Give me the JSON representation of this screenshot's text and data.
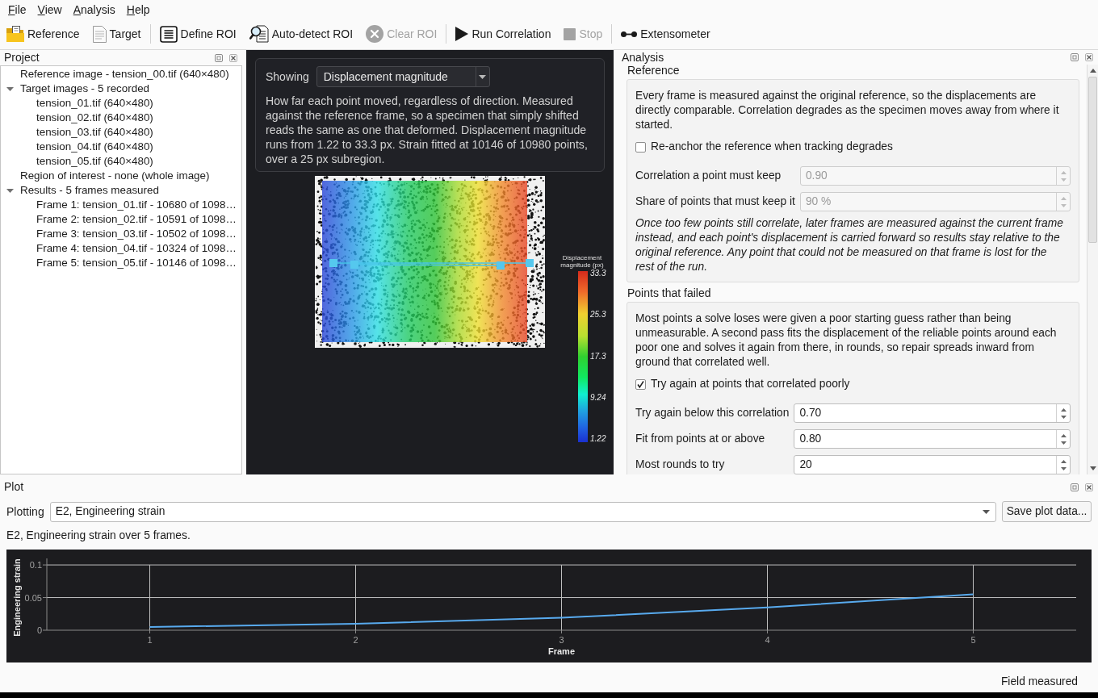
{
  "menu": [
    "File",
    "View",
    "Analysis",
    "Help"
  ],
  "toolbar": {
    "groups": [
      [
        {
          "label": "Reference",
          "disabled": false
        },
        {
          "label": "Target",
          "disabled": false
        }
      ],
      [
        {
          "label": "Define ROI",
          "disabled": false
        },
        {
          "label": "Auto-detect ROI",
          "disabled": false
        },
        {
          "label": "Clear ROI",
          "disabled": true
        }
      ],
      [
        {
          "label": "Run Correlation",
          "disabled": false
        },
        {
          "label": "Stop",
          "disabled": true
        }
      ],
      [
        {
          "label": "Extensometer",
          "disabled": false
        }
      ]
    ]
  },
  "project": {
    "title": "Project",
    "tree": [
      {
        "label": "Reference image - tension_00.tif (640×480)"
      },
      {
        "label": "Target images - 5 recorded",
        "expanded": true,
        "children": [
          {
            "label": "tension_01.tif (640×480)"
          },
          {
            "label": "tension_02.tif (640×480)"
          },
          {
            "label": "tension_03.tif (640×480)"
          },
          {
            "label": "tension_04.tif (640×480)"
          },
          {
            "label": "tension_05.tif (640×480)"
          }
        ]
      },
      {
        "label": "Region of interest - none (whole image)"
      },
      {
        "label": "Results - 5 frames measured",
        "expanded": true,
        "children": [
          {
            "label": "Frame 1: tension_01.tif - 10680 of 1098…"
          },
          {
            "label": "Frame 2: tension_02.tif - 10591 of 1098…"
          },
          {
            "label": "Frame 3: tension_03.tif - 10502 of 1098…"
          },
          {
            "label": "Frame 4: tension_04.tif - 10324 of 1098…"
          },
          {
            "label": "Frame 5: tension_05.tif - 10146 of 1098…"
          }
        ]
      }
    ]
  },
  "viewer": {
    "showing_label": "Showing",
    "showing_value": "Displacement magnitude",
    "description": "How far each point moved, regardless of direction. Measured against the reference frame, so a specimen that simply shifted reads the same as one that deformed. Displacement magnitude runs from 1.22 to 33.3 px. Strain fitted at 10146 of 10980 points, over a 25 px subregion.",
    "colorbar": {
      "title": "Displacement magnitude (px)",
      "ticks": [
        "33.3",
        "25.3",
        "17.3",
        "9.24",
        "1.22"
      ]
    }
  },
  "analysis": {
    "title": "Analysis",
    "groups": [
      {
        "title": "Reference",
        "items": [
          {
            "kind": "text",
            "text": "Every frame is measured against the original reference, so the displacements are directly comparable. Correlation degrades as the specimen moves away from where it started."
          },
          {
            "kind": "checkbox",
            "label": "Re-anchor the reference when tracking degrades",
            "checked": false
          },
          {
            "kind": "spin",
            "label": "Correlation a point must keep",
            "value": "0.90",
            "disabled": true
          },
          {
            "kind": "spin",
            "label": "Share of points that must keep it",
            "value": "90 %",
            "disabled": true
          },
          {
            "kind": "note",
            "text": "Once too few points still correlate, later frames are measured against the current frame instead, and each point's displacement is carried forward so results stay relative to the original reference. Any point that could not be measured on that frame is lost for the rest of the run."
          }
        ]
      },
      {
        "title": "Points that failed",
        "items": [
          {
            "kind": "text",
            "text": "Most points a solve loses were given a poor starting guess rather than being unmeasurable. A second pass fits the displacement of the reliable points around each poor one and solves it again from there, in rounds, so repair spreads inward from ground that correlated well."
          },
          {
            "kind": "checkbox",
            "label": "Try again at points that correlated poorly",
            "checked": true
          },
          {
            "kind": "spin",
            "label": "Try again below this correlation",
            "value": "0.70",
            "disabled": false
          },
          {
            "kind": "spin",
            "label": "Fit from points at or above",
            "value": "0.80",
            "disabled": false
          },
          {
            "kind": "spin",
            "label": "Most rounds to try",
            "value": "20",
            "disabled": false
          }
        ]
      }
    ]
  },
  "plot": {
    "title": "Plot",
    "plotting_label": "Plotting",
    "plotting_value": "E2, Engineering strain",
    "save_button": "Save plot data...",
    "caption": "E2, Engineering strain over 5 frames.",
    "chart_data": {
      "type": "line",
      "xlabel": "Frame",
      "ylabel": "Engineering strain",
      "x": [
        1,
        2,
        3,
        4,
        5
      ],
      "series": [
        {
          "color": "#58aaee",
          "values": [
            0.005,
            0.01,
            0.019,
            0.035,
            0.055
          ]
        }
      ],
      "xlim": [
        0.5,
        5.5
      ],
      "ylim": [
        0,
        0.11
      ],
      "xticks": [
        1,
        2,
        3,
        4,
        5
      ],
      "yticks": [
        0,
        0.05,
        0.1
      ],
      "grid": true
    }
  },
  "status_bar": {
    "text": "Field measured"
  }
}
